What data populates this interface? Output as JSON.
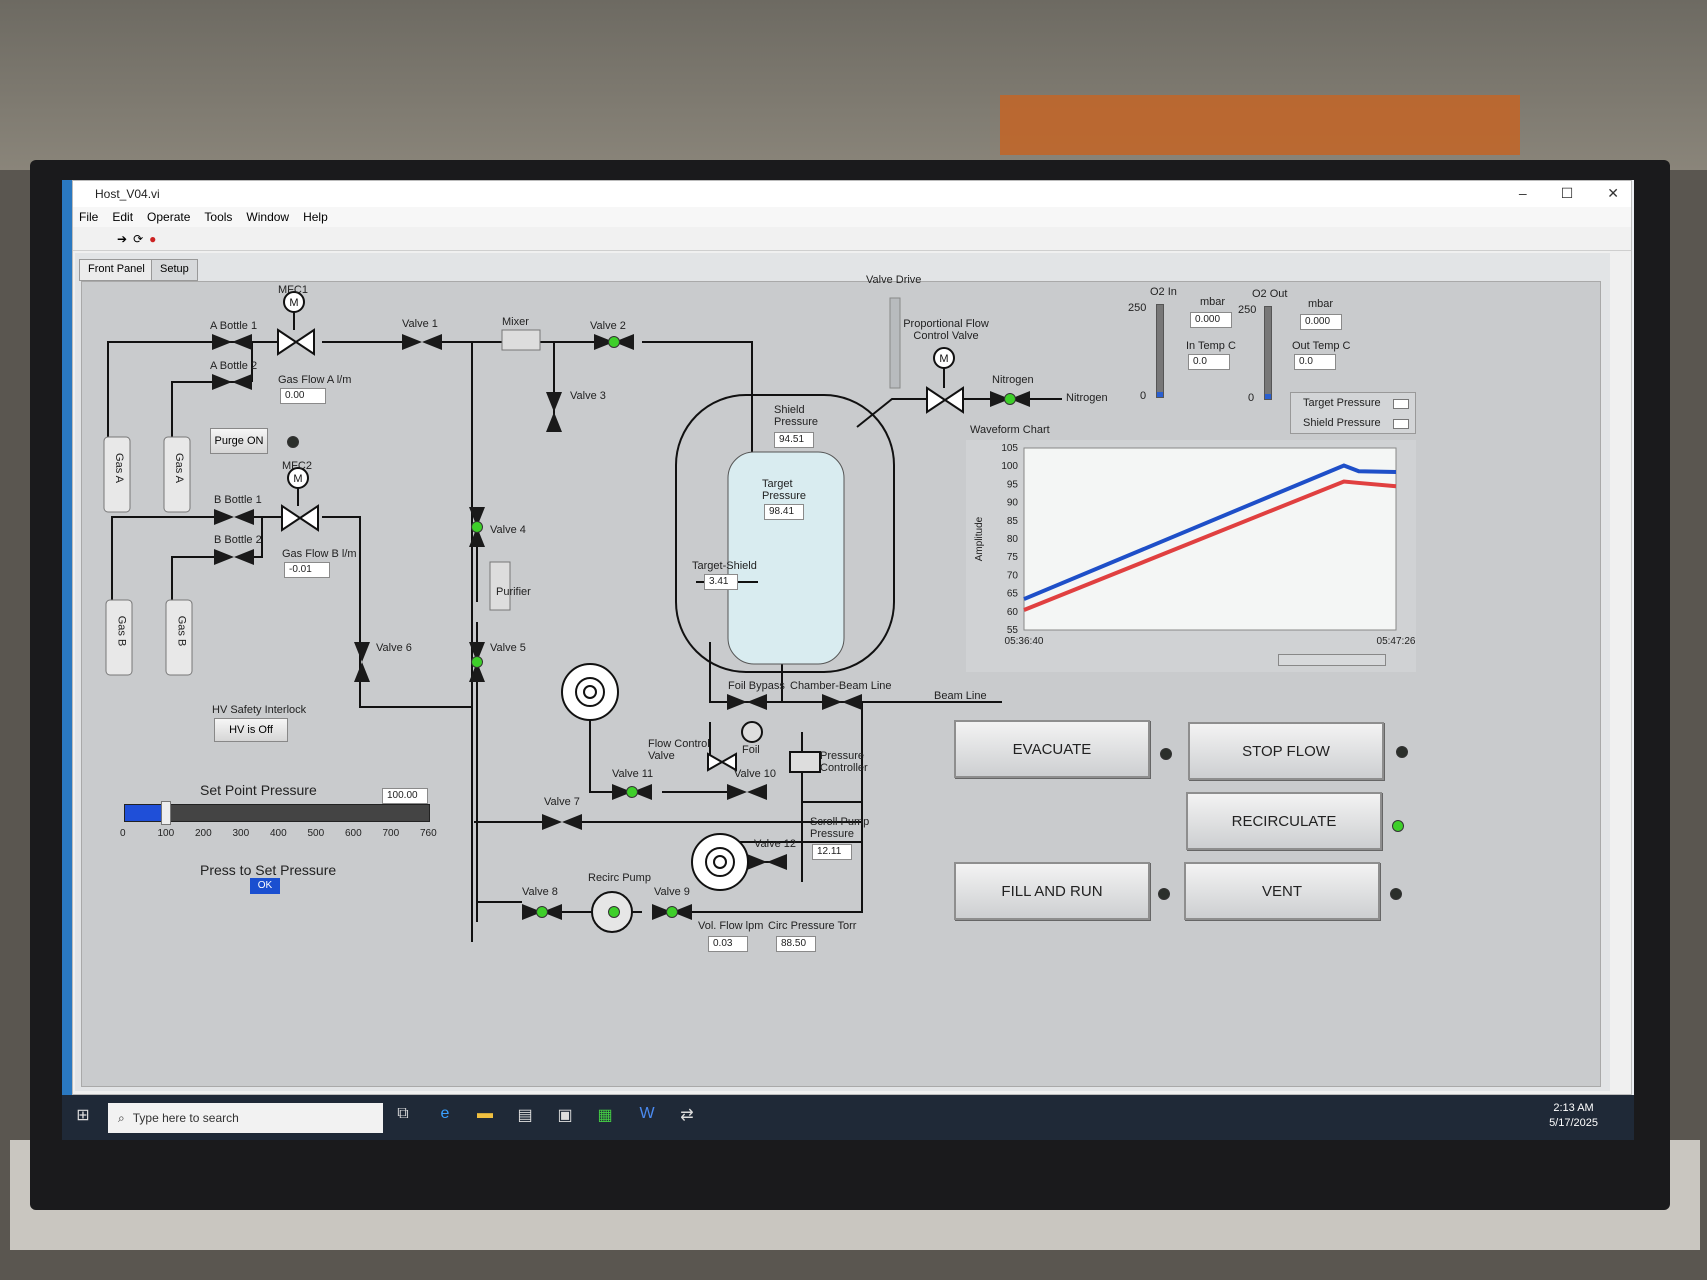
{
  "window": {
    "title": "Host_V04.vi",
    "controls": [
      "–",
      "☐",
      "✕"
    ]
  },
  "menu": [
    "File",
    "Edit",
    "Operate",
    "Tools",
    "Window",
    "Help"
  ],
  "tabs": [
    "Front Panel",
    "Setup"
  ],
  "diagram": {
    "mfc1": "MFC1",
    "mfc2": "MFC2",
    "a_bottle1": "A Bottle 1",
    "a_bottle2": "A Bottle 2",
    "b_bottle1": "B Bottle 1",
    "b_bottle2": "B Bottle 2",
    "gas_a": "Gas A",
    "gas_b": "Gas B",
    "gas_flow_a_label": "Gas Flow A l/m",
    "gas_flow_a": "0.00",
    "gas_flow_b_label": "Gas Flow B l/m",
    "gas_flow_b": "-0.01",
    "purge_button": "Purge ON",
    "valve1": "Valve 1",
    "valve2": "Valve 2",
    "valve3": "Valve 3",
    "valve4": "Valve 4",
    "valve5": "Valve 5",
    "valve6": "Valve 6",
    "valve7": "Valve 7",
    "valve8": "Valve 8",
    "valve9": "Valve 9",
    "valve10": "Valve 10",
    "valve11": "Valve 11",
    "valve12": "Valve 12",
    "mixer": "Mixer",
    "purifier": "Purifier",
    "valve_drive": "Valve Drive",
    "prop_valve": "Proportional Flow Control Valve",
    "nitrogen_valve": "Nitrogen",
    "nitrogen_out": "Nitrogen",
    "shield_pressure_label": "Shield Pressure",
    "shield_pressure": "94.51",
    "target_pressure_label": "Target Pressure",
    "target_pressure": "98.41",
    "target_shield_label": "Target-Shield",
    "target_shield": "3.41",
    "foil_bypass": "Foil Bypass",
    "chamber_beam_line": "Chamber-Beam Line",
    "beam_line": "Beam Line",
    "foil": "Foil",
    "flow_control_valve": "Flow Control Valve",
    "pressure_controller": "Pressure Controller",
    "scroll_pump_label": "Scroll Pump Pressure",
    "scroll_pump": "12.11",
    "recirc_pump": "Recirc Pump",
    "vol_flow_label": "Vol. Flow lpm",
    "vol_flow": "0.03",
    "circ_pressure_label": "Circ Pressure Torr",
    "circ_pressure": "88.50",
    "hv_interlock_label": "HV Safety Interlock",
    "hv_button": "HV is Off"
  },
  "o2": {
    "o2_in": "O2 In",
    "o2_out": "O2 Out",
    "mbar": "mbar",
    "o2_in_val": "0.000",
    "o2_out_val": "0.000",
    "in_temp_label": "In Temp C",
    "in_temp": "0.0",
    "out_temp_label": "Out Temp C",
    "out_temp": "0.0",
    "scale_max": "250",
    "scale_min": "0"
  },
  "legend": {
    "target": "Target Pressure",
    "shield": "Shield Pressure"
  },
  "setpoint": {
    "label": "Set Point Pressure",
    "value": "100.00",
    "ticks": [
      "0",
      "100",
      "200",
      "300",
      "400",
      "500",
      "600",
      "700",
      "760"
    ],
    "press_label": "Press to Set Pressure",
    "ok": "OK"
  },
  "buttons": {
    "evacuate": "EVACUATE",
    "stop_flow": "STOP FLOW",
    "recirculate": "RECIRCULATE",
    "fill_and_run": "FILL AND RUN",
    "vent": "VENT"
  },
  "colors": {
    "led_on": "#3ecf2a",
    "led_off": "#2b2f2b",
    "target_line": "#1e4fc8",
    "shield_line": "#e04040"
  },
  "chart_data": {
    "type": "line",
    "title": "Waveform Chart",
    "ylabel": "Amplitude",
    "xlabel": "",
    "ylim": [
      55,
      105
    ],
    "yticks": [
      "105",
      "100",
      "95",
      "90",
      "85",
      "80",
      "75",
      "70",
      "65",
      "60",
      "55"
    ],
    "xticks": [
      "05:36:40",
      "05:47:26"
    ],
    "x": [
      0,
      0.86,
      0.9,
      1.0
    ],
    "series": [
      {
        "name": "Target Pressure",
        "values": [
          63.5,
          100.2,
          98.6,
          98.4
        ]
      },
      {
        "name": "Shield Pressure",
        "values": [
          60.5,
          95.8,
          95.4,
          94.5
        ]
      }
    ]
  },
  "taskbar": {
    "search": "Type here to search",
    "time": "2:13 AM",
    "date": "5/17/2025"
  }
}
